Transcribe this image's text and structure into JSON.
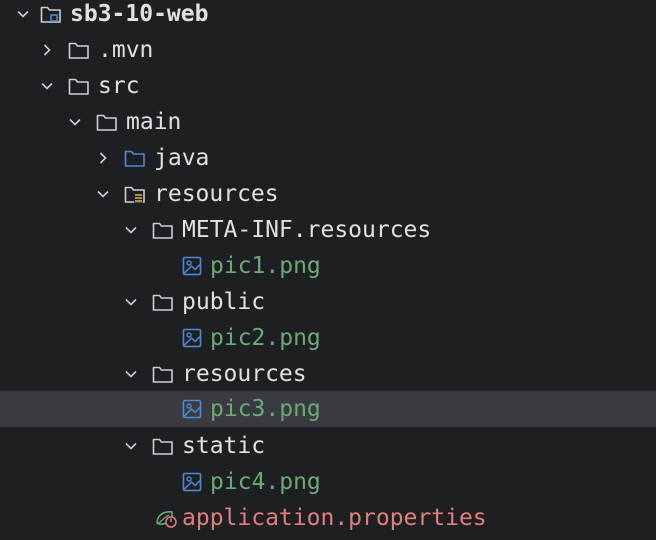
{
  "project_tree": {
    "root": {
      "label": "sb3-10-web"
    },
    "mvn": {
      "label": ".mvn"
    },
    "src": {
      "label": "src"
    },
    "main": {
      "label": "main"
    },
    "java": {
      "label": "java"
    },
    "resources": {
      "label": "resources"
    },
    "meta_inf": {
      "label": "META-INF.resources"
    },
    "pic1": {
      "label": "pic1.png"
    },
    "public": {
      "label": "public"
    },
    "pic2": {
      "label": "pic2.png"
    },
    "resources_sub": {
      "label": "resources"
    },
    "pic3": {
      "label": "pic3.png"
    },
    "static": {
      "label": "static"
    },
    "pic4": {
      "label": "pic4.png"
    },
    "app_props": {
      "label": "application.properties"
    }
  },
  "colors": {
    "background": "#1e1f22",
    "selected_row": "#393b40",
    "text": "#dfe1e5",
    "image_file_text": "#6aab73",
    "properties_text": "#e17f79",
    "java_folder_icon": "#4e8ad7",
    "image_icon": "#4e8ad7"
  }
}
